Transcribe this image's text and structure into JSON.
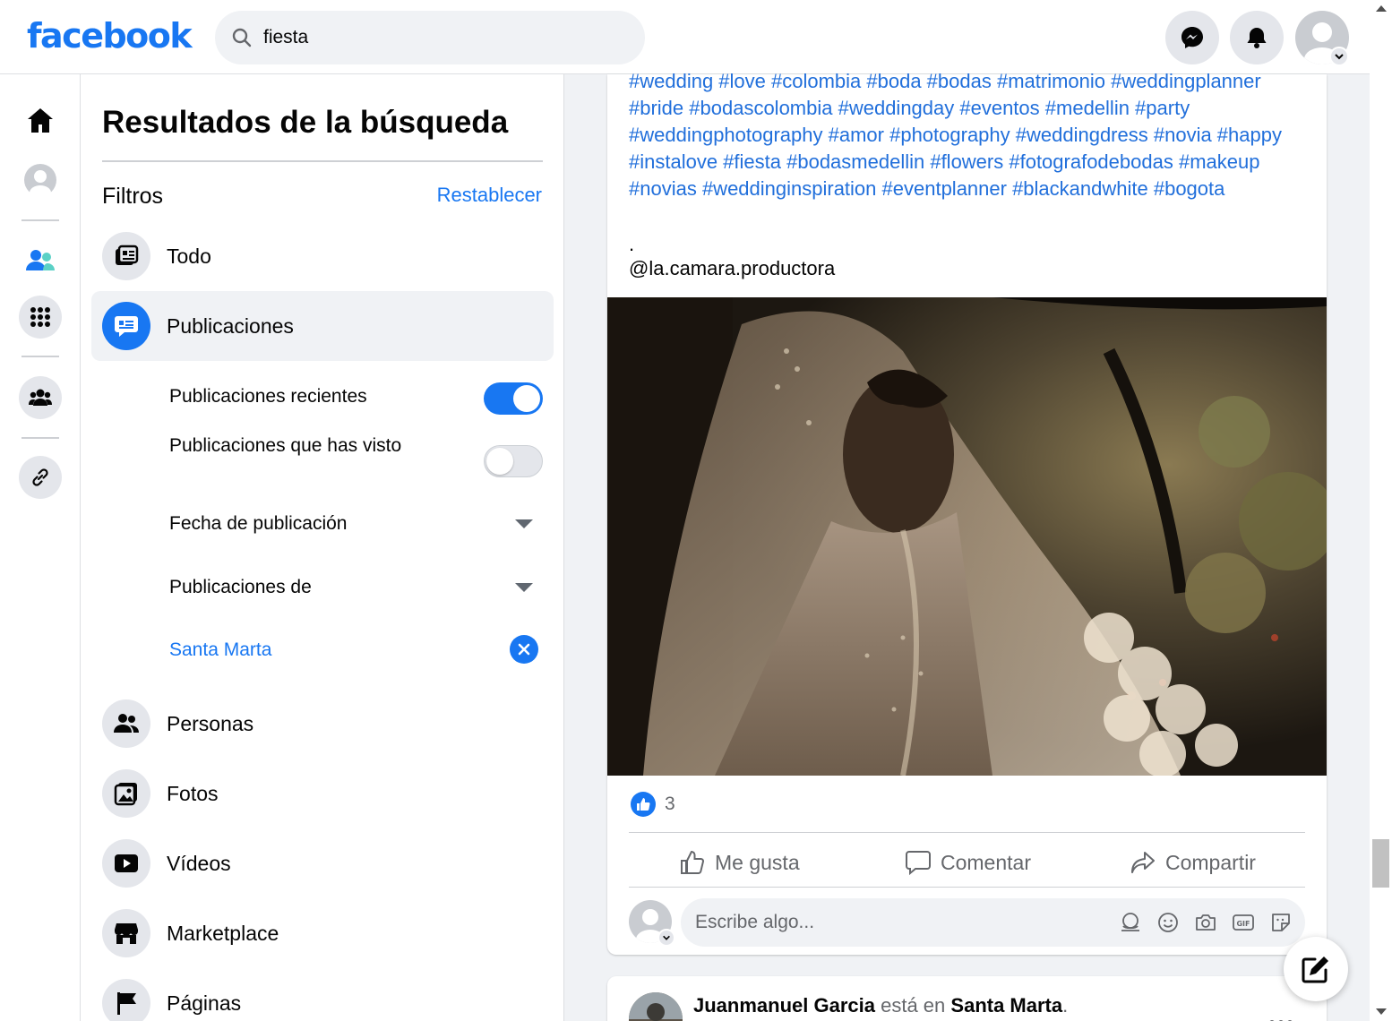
{
  "header": {
    "logo": "facebook",
    "search_value": "fiesta"
  },
  "panel": {
    "title": "Resultados de la búsqueda",
    "filters_label": "Filtros",
    "reset_label": "Restablecer",
    "categories": [
      {
        "label": "Todo",
        "icon": "feed-icon",
        "active": false
      },
      {
        "label": "Publicaciones",
        "icon": "posts-icon",
        "active": true
      },
      {
        "label": "Personas",
        "icon": "people-icon",
        "active": false
      },
      {
        "label": "Fotos",
        "icon": "photos-icon",
        "active": false
      },
      {
        "label": "Vídeos",
        "icon": "video-icon",
        "active": false
      },
      {
        "label": "Marketplace",
        "icon": "marketplace-icon",
        "active": false
      },
      {
        "label": "Páginas",
        "icon": "flag-icon",
        "active": false
      }
    ],
    "subfilters": {
      "recent_label": "Publicaciones recientes",
      "recent_on": true,
      "seen_label": "Publicaciones que has visto",
      "seen_on": false,
      "date_label": "Fecha de publicación",
      "from_label": "Publicaciones de",
      "location_label": "Santa Marta"
    }
  },
  "post": {
    "hashtags": "#wedding #love #colombia #boda #bodas #matrimonio #weddingplanner #bride #bodascolombia #weddingday #eventos #medellin #party #weddingphotography #amor #photography #weddingdress #novia #happy #instalove #fiesta #bodasmedellin #flowers #fotografodebodas #makeup #novias #weddinginspiration #eventplanner #blackandwhite #bogota",
    "dot": ".",
    "mention": "@la.camara.productora",
    "like_count": "3",
    "actions": {
      "like": "Me gusta",
      "comment": "Comentar",
      "share": "Compartir"
    },
    "comment_placeholder": "Escribe algo..."
  },
  "next_post": {
    "author": "Juanmanuel Garcia",
    "connector": "está en",
    "place": "Santa Marta",
    "suffix": "."
  },
  "colors": {
    "brand": "#1877f2",
    "hashtag": "#216fdb",
    "panel_bg": "#ffffff",
    "page_bg": "#f0f2f5"
  }
}
